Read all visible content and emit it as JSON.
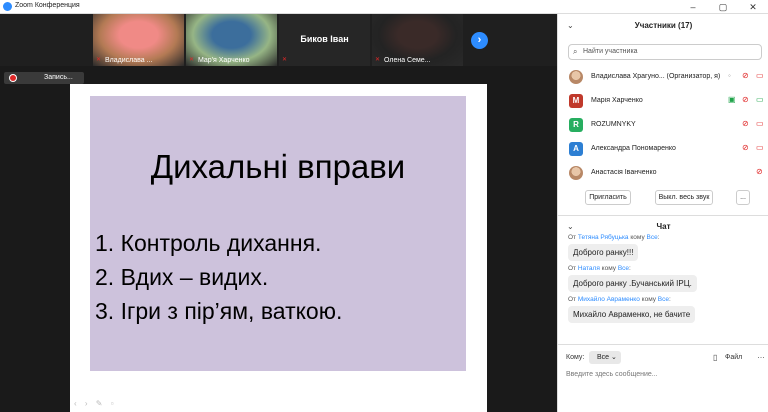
{
  "window": {
    "title": "Zoom Конференция"
  },
  "thumbs": [
    {
      "name": "Владислава ...",
      "muted": true,
      "photo_colors": [
        "#b37a54",
        "#f08a86"
      ]
    },
    {
      "name": "Мар'я Харченко",
      "muted": true,
      "photo_colors": [
        "#96b585",
        "#3c6e9c"
      ],
      "active": true
    },
    {
      "label": "Биков Іван",
      "muted": true
    },
    {
      "name": "Олена Семе...",
      "muted": true,
      "photo_colors": [
        "#232323",
        "#3a2a28"
      ]
    }
  ],
  "recording": {
    "label": "Запись..."
  },
  "slide": {
    "title": "Дихальні вправи",
    "items": [
      "1.  Контроль дихання.",
      "2.  Вдих – видих.",
      "3.   Ігри з пір’ям, ваткою."
    ]
  },
  "participants": {
    "title": "Участники (17)",
    "search_placeholder": "Найти участника",
    "list": [
      {
        "name": "Владислава Храгуно... (Организатор, я)",
        "avatar_letter": "",
        "avatar_color": "photo"
      },
      {
        "name": "Марія Харченко",
        "avatar_letter": "М",
        "avatar_color": "#c0392b"
      },
      {
        "name": "ROZUMNYKY",
        "avatar_letter": "R",
        "avatar_color": "#27ae60"
      },
      {
        "name": "Александра Пономаренко",
        "avatar_letter": "А",
        "avatar_color": "#2d7fd3"
      },
      {
        "name": "Анастасія Іванченко",
        "avatar_letter": "",
        "avatar_color": "photo"
      }
    ],
    "invite_label": "Пригласить",
    "mute_all_label": "Выкл. весь звук",
    "more_label": "..."
  },
  "chat": {
    "title": "Чат",
    "messages": [
      {
        "from": "Тетяна Рябуцька",
        "to": "Все",
        "text": "Доброго ранку!!!"
      },
      {
        "from": "Наталя",
        "to": "Все",
        "text": "Доброго ранку .Бучанський ІРЦ."
      },
      {
        "from": "Михайло Авраменко",
        "to": "Все",
        "text": "Михайло Авраменко, не бачите"
      }
    ],
    "word_from": "От",
    "word_to": "кому",
    "to_label": "Кому:",
    "to_value": "Все",
    "file_label": "Файл",
    "input_placeholder": "Введите здесь сообщение..."
  }
}
